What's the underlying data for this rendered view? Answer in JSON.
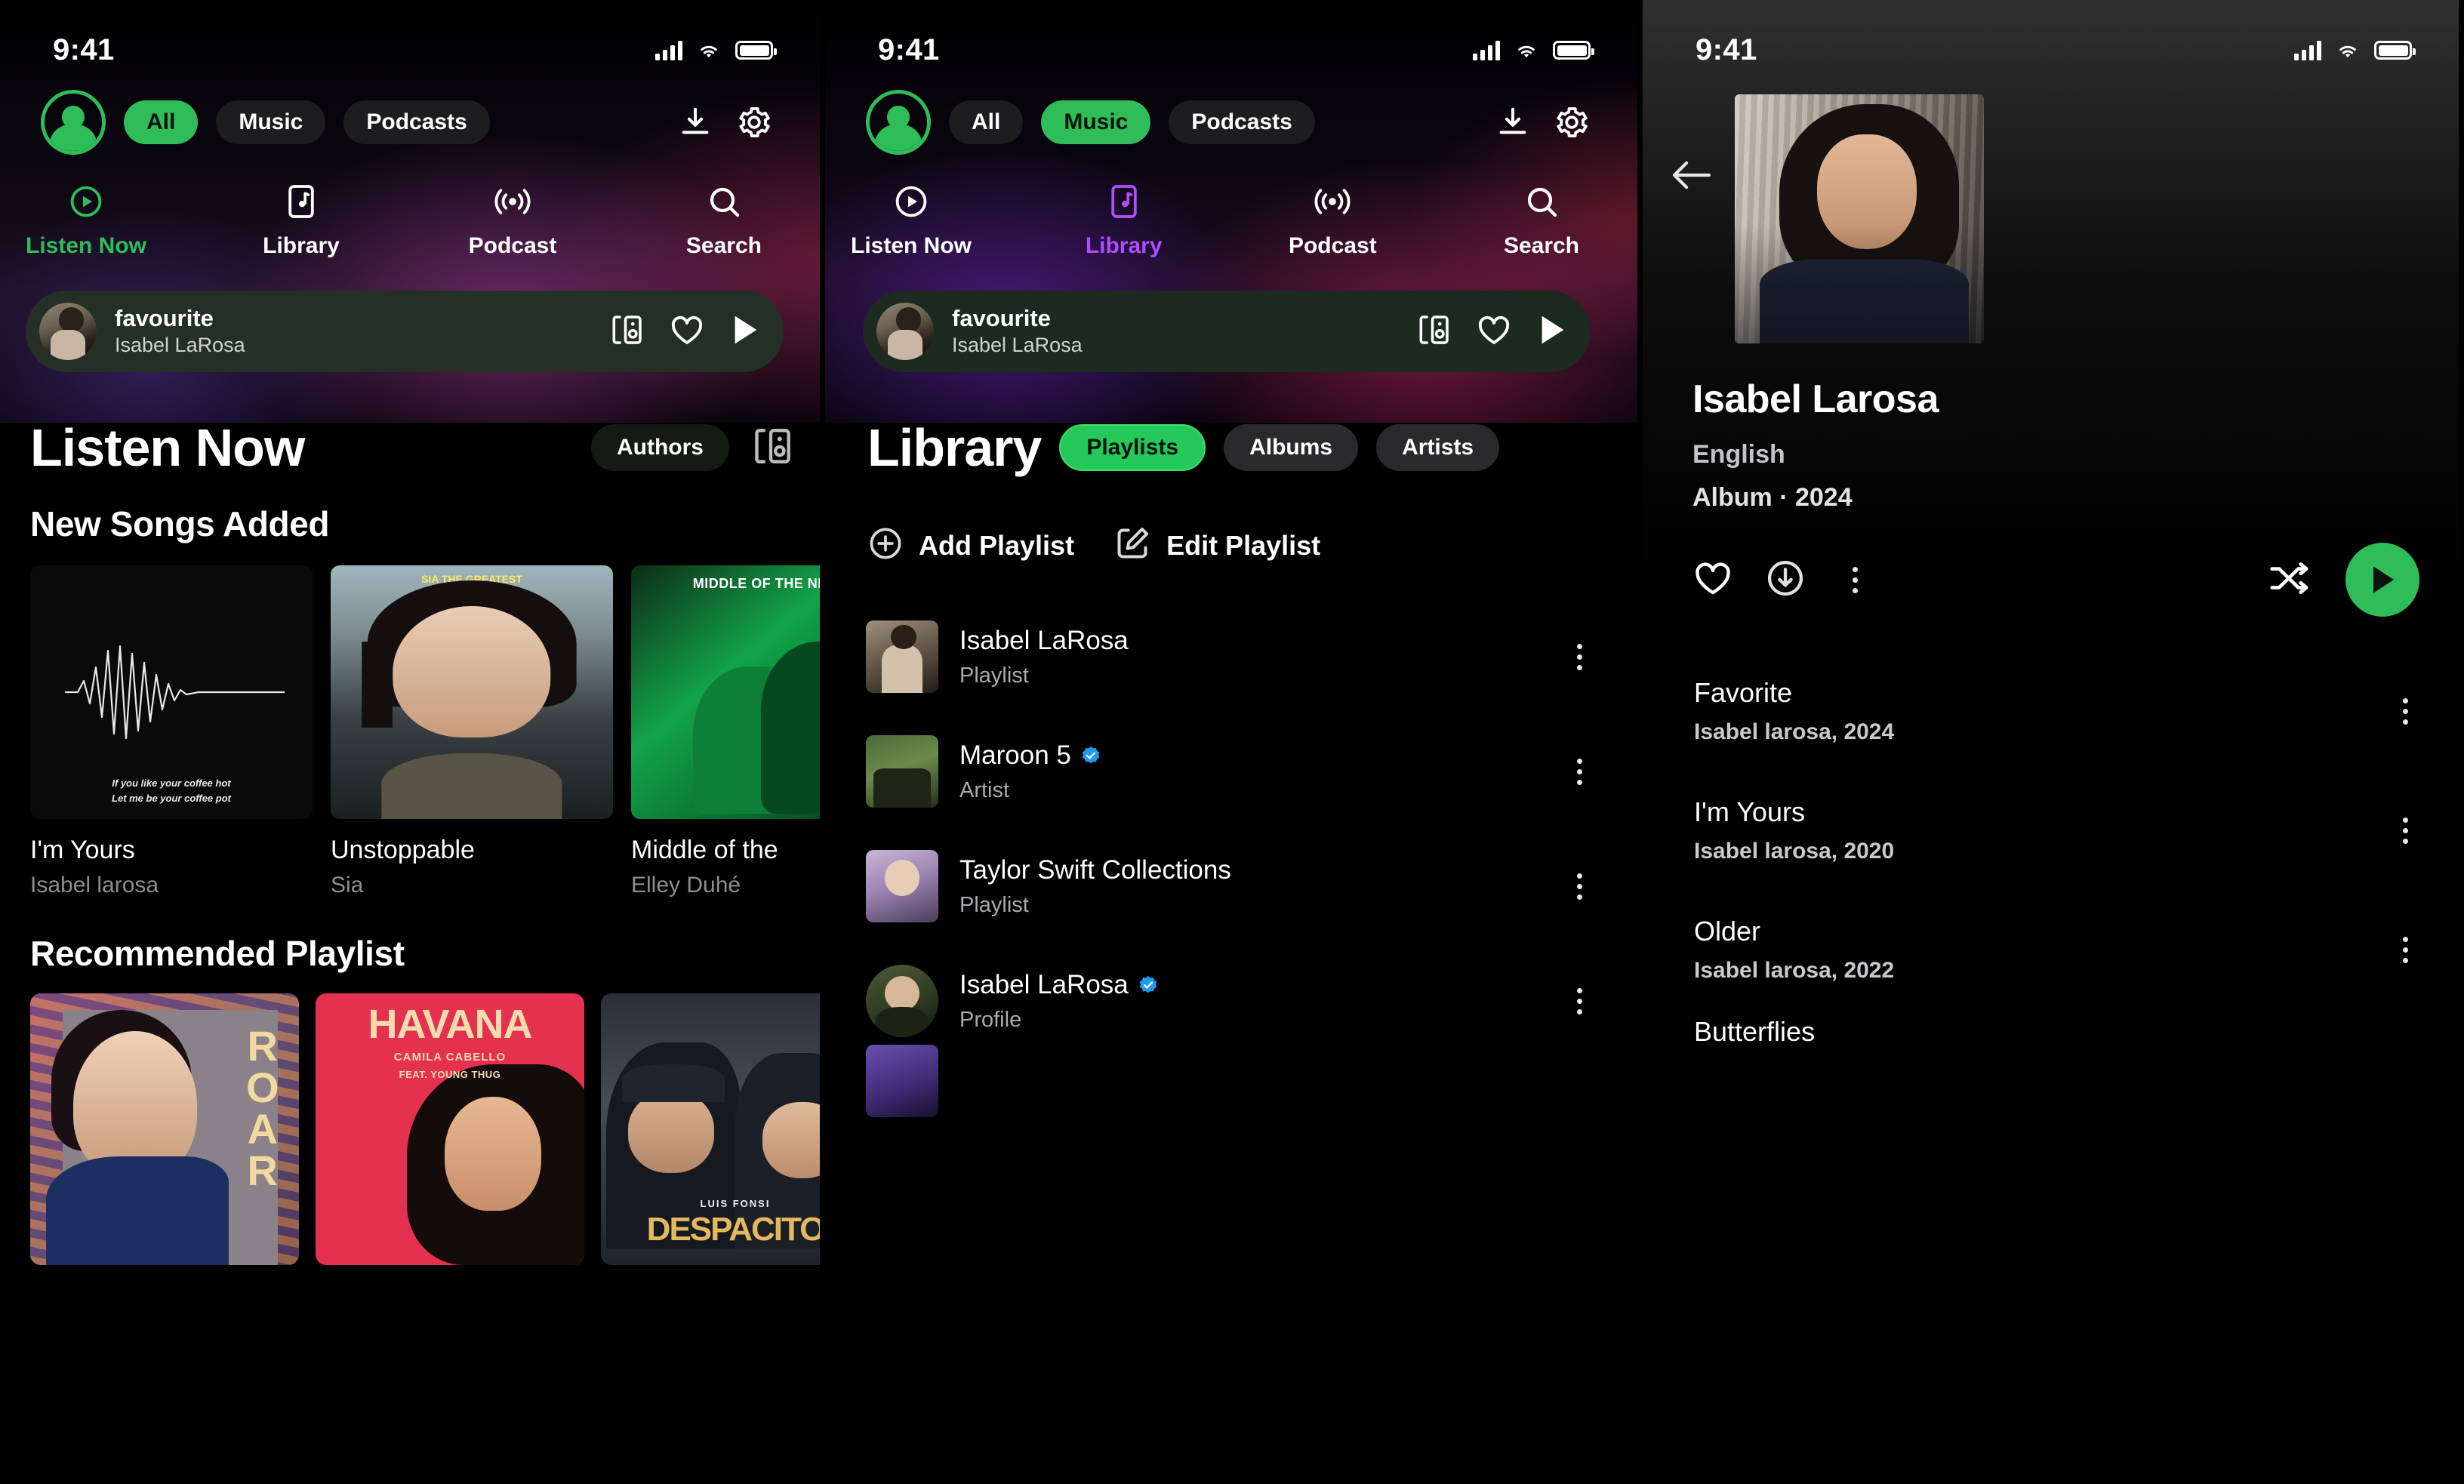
{
  "status_bar": {
    "time": "9:41",
    "signal_icon": "cellular-signal-icon",
    "wifi_icon": "wifi-icon",
    "battery_icon": "battery-full-icon"
  },
  "panel1": {
    "avatar_icon": "profile-avatar-icon",
    "filter_chips": [
      {
        "label": "All",
        "active": true
      },
      {
        "label": "Music",
        "active": false
      },
      {
        "label": "Podcasts",
        "active": false
      }
    ],
    "download_icon": "download-icon",
    "settings_icon": "gear-icon",
    "nav_tabs": [
      {
        "label": "Listen Now",
        "icon": "play-circle-icon",
        "active": true
      },
      {
        "label": "Library",
        "icon": "music-library-icon",
        "active": false
      },
      {
        "label": "Podcast",
        "icon": "broadcast-icon",
        "active": false
      },
      {
        "label": "Search",
        "icon": "search-icon",
        "active": false
      }
    ],
    "now_playing": {
      "title": "favourite",
      "artist": "Isabel LaRosa",
      "connect_icon": "spotify-connect-icon",
      "like_icon": "heart-icon",
      "play_icon": "play-icon"
    },
    "page_title": "Listen Now",
    "authors_pill": "Authors",
    "connect_icon": "spotify-connect-icon",
    "section_new_songs": "New Songs Added",
    "new_songs": [
      {
        "name": "I'm Yours",
        "artist": "Isabel larosa",
        "art": "waveform",
        "art_text_line1": "If you like your coffee hot",
        "art_text_line2": "Let me be your coffee pot"
      },
      {
        "name": "Unstoppable",
        "artist": "Sia",
        "art": "portrait",
        "art_text_line1": "SIA THE GREATEST",
        "art_text_line2": ""
      },
      {
        "name": "Middle of the",
        "artist": "Elley Duhé",
        "art": "green",
        "art_text_line1": "MIDDLE OF THE NIGHT",
        "art_text_line2": ""
      }
    ],
    "section_recommended": "Recommended Playlist",
    "recommended": [
      {
        "name": "Roar",
        "lines": [
          "R",
          "O",
          "A",
          "R"
        ]
      },
      {
        "name": "Havana",
        "title": "HAVANA",
        "sub1": "CAMILA CABELLO",
        "sub2": "FEAT. YOUNG THUG"
      },
      {
        "name": "Despacito",
        "sub": "LUIS FONSI",
        "title": "DESPACITO"
      }
    ]
  },
  "panel2": {
    "avatar_icon": "profile-avatar-icon",
    "filter_chips": [
      {
        "label": "All",
        "active": false
      },
      {
        "label": "Music",
        "active": true
      },
      {
        "label": "Podcasts",
        "active": false
      }
    ],
    "download_icon": "download-icon",
    "settings_icon": "gear-icon",
    "nav_tabs": [
      {
        "label": "Listen Now",
        "icon": "play-circle-icon",
        "active": false
      },
      {
        "label": "Library",
        "icon": "music-library-icon",
        "active": true
      },
      {
        "label": "Podcast",
        "icon": "broadcast-icon",
        "active": false
      },
      {
        "label": "Search",
        "icon": "search-icon",
        "active": false
      }
    ],
    "now_playing": {
      "title": "favourite",
      "artist": "Isabel LaRosa",
      "connect_icon": "spotify-connect-icon",
      "like_icon": "heart-icon",
      "play_icon": "play-icon"
    },
    "page_title": "Library",
    "segment_pills": [
      {
        "label": "Playlists",
        "active": true
      },
      {
        "label": "Albums",
        "active": false
      },
      {
        "label": "Artists",
        "active": false
      }
    ],
    "add_playlist": {
      "label": "Add Playlist",
      "icon": "plus-circle-icon"
    },
    "edit_playlist": {
      "label": "Edit Playlist",
      "icon": "edit-pencil-icon"
    },
    "items": [
      {
        "name": "Isabel LaRosa",
        "type": "Playlist",
        "verified": false,
        "round": false,
        "art": "a-larosa"
      },
      {
        "name": "Maroon 5",
        "type": "Artist",
        "verified": true,
        "round": false,
        "art": "a-maroon"
      },
      {
        "name": "Taylor Swift Collections",
        "type": "Playlist",
        "verified": false,
        "round": false,
        "art": "a-taylor"
      },
      {
        "name": "Isabel LaRosa",
        "type": "Profile",
        "verified": true,
        "round": true,
        "art": "a-profile"
      }
    ],
    "kebab_icon": "more-vertical-icon"
  },
  "panel3": {
    "back_icon": "back-arrow-icon",
    "hero_art": "artist-hero-image",
    "artist_name": "Isabel Larosa",
    "language": "English",
    "meta": "Album · 2024",
    "actions": [
      {
        "icon": "heart-icon",
        "name": "like-button"
      },
      {
        "icon": "download-circle-icon",
        "name": "download-button"
      },
      {
        "icon": "more-vertical-icon",
        "name": "more-button"
      },
      {
        "icon": "shuffle-icon",
        "name": "shuffle-button"
      },
      {
        "icon": "play-icon",
        "name": "play-button"
      }
    ],
    "tracks": [
      {
        "title": "Favorite",
        "sub": "Isabel larosa, 2024"
      },
      {
        "title": "I'm Yours",
        "sub": "Isabel larosa, 2020"
      },
      {
        "title": "Older",
        "sub": "Isabel larosa, 2022"
      },
      {
        "title": "Butterflies",
        "sub": ""
      }
    ],
    "kebab_icon": "more-vertical-icon"
  },
  "colors": {
    "spotify_green": "#2ebd59",
    "accent_purple": "#b14bff",
    "verified_blue": "#1d9bf0",
    "background": "#000000"
  }
}
